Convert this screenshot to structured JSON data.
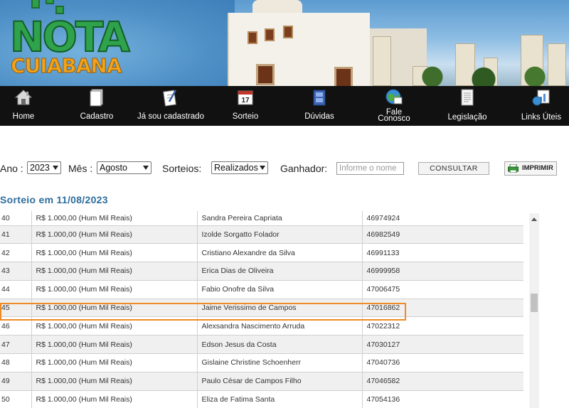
{
  "logo": {
    "word1": "NOTA",
    "word2": "CUIABANA"
  },
  "nav": [
    {
      "label": "Home",
      "icon": "home-icon"
    },
    {
      "label": "Cadastro",
      "icon": "document-icon"
    },
    {
      "label": "Já sou cadastrado",
      "icon": "pen-paper-icon"
    },
    {
      "label": "Sorteio",
      "icon": "calendar-icon"
    },
    {
      "label": "Dúvidas",
      "icon": "help-book-icon"
    },
    {
      "label_line1": "Fale",
      "label_line2": "Conosco",
      "icon": "globe-mail-icon"
    },
    {
      "label": "Legislação",
      "icon": "law-document-icon"
    },
    {
      "label": "Links Úteis",
      "icon": "chart-globe-icon"
    }
  ],
  "filters": {
    "ano_label": "Ano :",
    "ano_value": "2023",
    "mes_label": "Mês :",
    "mes_value": "Agosto",
    "sorteios_label": "Sorteios:",
    "sorteios_value": "Realizados",
    "ganhador_label": "Ganhador:",
    "ganhador_placeholder": "Informe o nome",
    "consultar_label": "CONSULTAR",
    "imprimir_label": "IMPRIMIR"
  },
  "section_title": "Sorteio em 11/08/2023",
  "rows": [
    {
      "num": "40",
      "valor": "R$ 1.000,00 (Hum Mil Reais)",
      "nome": "Sandra Pereira Capriata",
      "codigo": "46974924"
    },
    {
      "num": "41",
      "valor": "R$ 1.000,00 (Hum Mil Reais)",
      "nome": "Izolde Sorgatto Folador",
      "codigo": "46982549"
    },
    {
      "num": "42",
      "valor": "R$ 1.000,00 (Hum Mil Reais)",
      "nome": "Cristiano Alexandre da Silva",
      "codigo": "46991133"
    },
    {
      "num": "43",
      "valor": "R$ 1.000,00 (Hum Mil Reais)",
      "nome": "Erica Dias de Oliveira",
      "codigo": "46999958"
    },
    {
      "num": "44",
      "valor": "R$ 1.000,00 (Hum Mil Reais)",
      "nome": "Fabio Onofre da Silva",
      "codigo": "47006475"
    },
    {
      "num": "45",
      "valor": "R$ 1.000,00 (Hum Mil Reais)",
      "nome": "Jaime Verissimo de Campos",
      "codigo": "47016862"
    },
    {
      "num": "46",
      "valor": "R$ 1.000,00 (Hum Mil Reais)",
      "nome": "Alexsandra Nascimento Arruda",
      "codigo": "47022312"
    },
    {
      "num": "47",
      "valor": "R$ 1.000,00 (Hum Mil Reais)",
      "nome": "Edson Jesus da Costa",
      "codigo": "47030127"
    },
    {
      "num": "48",
      "valor": "R$ 1.000,00 (Hum Mil Reais)",
      "nome": "Gislaine Christine Schoenherr",
      "codigo": "47040736"
    },
    {
      "num": "49",
      "valor": "R$ 1.000,00 (Hum Mil Reais)",
      "nome": "Paulo César de Campos Filho",
      "codigo": "47046582"
    },
    {
      "num": "50",
      "valor": "R$ 1.000,00 (Hum Mil Reais)",
      "nome": "Eliza de Fatima Santa",
      "codigo": "47054136"
    }
  ],
  "highlight_color": "#f08a24",
  "title_color": "#2d6d9c"
}
